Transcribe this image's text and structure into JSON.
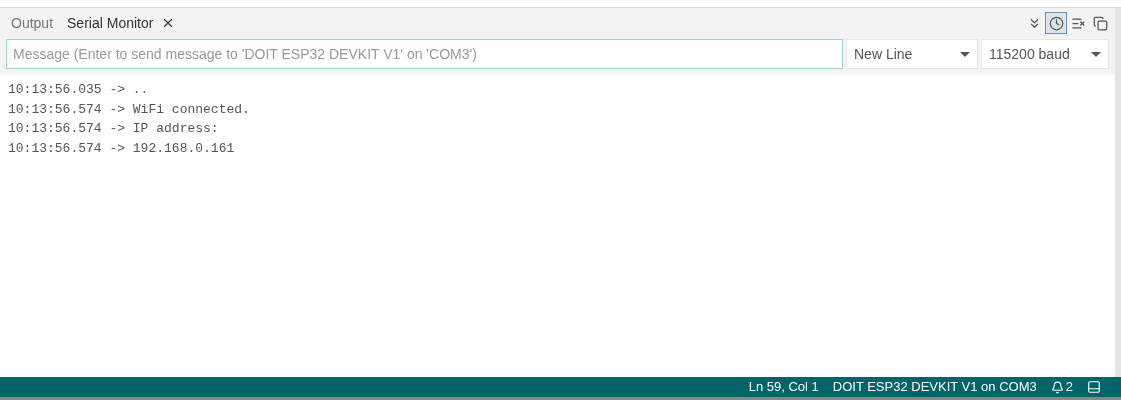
{
  "tabs": [
    {
      "label": "Output",
      "selected": false,
      "closable": false
    },
    {
      "label": "Serial Monitor",
      "selected": true,
      "closable": true
    }
  ],
  "toolbar": [
    {
      "kind": "autoscroll",
      "selected": false
    },
    {
      "kind": "timestamp",
      "selected": true
    },
    {
      "kind": "clear",
      "selected": false
    },
    {
      "kind": "copy",
      "selected": false
    }
  ],
  "message": {
    "placeholder": "Message (Enter to send message to 'DOIT ESP32 DEVKIT V1' on 'COM3')"
  },
  "dropdowns": [
    {
      "value": "New Line"
    },
    {
      "value": "115200 baud"
    }
  ],
  "log": [
    "10:13:56.035 -> ..",
    "10:13:56.574 -> WiFi connected.",
    "10:13:56.574 -> IP address:",
    "10:13:56.574 -> 192.168.0.161"
  ],
  "status_bar": {
    "position": "Ln 59, Col 1",
    "board": "DOIT ESP32 DEVKIT V1 on COM3",
    "notifications": "2"
  }
}
